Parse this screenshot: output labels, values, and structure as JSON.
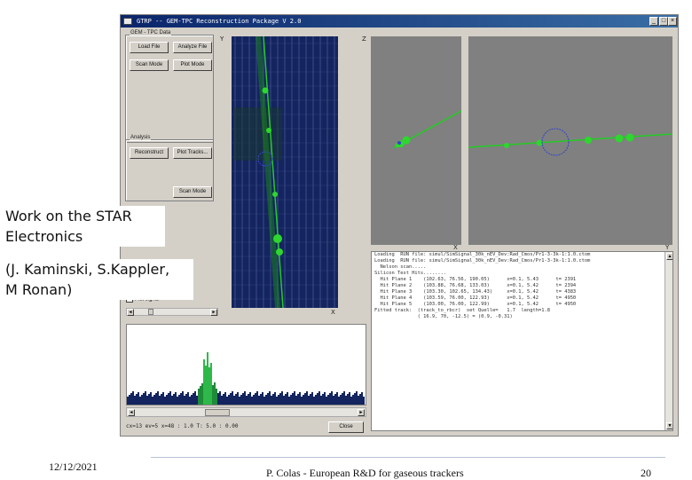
{
  "window": {
    "title": "GTRP -- GEM-TPC Reconstruction Package V 2.0",
    "title_icon": "app-logo-icon",
    "controls": {
      "minimize": "_",
      "maximize": "□",
      "close": "×"
    }
  },
  "left_panel": {
    "group1_label": "GEM - TPC Data",
    "buttons_row1": [
      "Load File",
      "Analyze File"
    ],
    "buttons_row2": [
      "Scan Mode",
      "Plot Mode"
    ],
    "group2_label": "Analysis",
    "buttons_row3": [
      "Reconstruct",
      "Plot Tracks..."
    ],
    "scan_button": "Scan Mode",
    "checkbox_label": "Plot signal",
    "checkbox_checked": true
  },
  "plots": {
    "xy_axis_y": "Y",
    "xy_axis_x": "X",
    "zx_axis_z": "Z",
    "zx_axis_x": "X",
    "zy_axis_y": "Y"
  },
  "console_lines": [
    "Loading  RUN file: simul/SimSignal_30k_nEV_Dev:Rad_Cmos/Pr1-3-3k-1:1.0.ctom",
    "Loading  RUN file: simul/SimSignal_30k_nEV_Dev:Rad_Cmos/Pr1-3-3k-1:1.0.ctom",
    "  Nelson scan.....",
    "Silicon Test Hits........",
    "  Hit Plane 1    (102.63, 76.56, 190.05)      x=0.1, 5.43      t= 2391",
    "  Hit Plane 2    (103.88, 76.68, 133.03)      x=0.1, 5.42      t= 2394",
    "  Hit Plane 3    (103.30, 102.65, 134.43)     x=0.1, 5.42      t= 4383",
    "  Hit Plane 4    (103.59, 76.00, 122.93)      x=0.1, 5.42      t= 4950",
    "  Hit Plane 5    (103.00, 76.00, 122.99)      x=0.1, 5.42      t= 4950",
    "Fitted track:  (track_to_rbcr)  set Quelle=   1.7  length=1.8",
    "               ( 16.9, 70, -12.5) = (0.9, -0.31)"
  ],
  "status_line": "cx=13 ev=5 x=48 : 1.0  T: 5.0 : 0.00",
  "close_button": "Close",
  "slide": {
    "text1_line1": "Work on the STAR",
    "text1_line2": "Electronics",
    "text2_line1": "(J. Kaminski, S.Kappler,",
    "text2_line2": "M Ronan)",
    "footer_date": "12/12/2021",
    "footer_center": "P. Colas  - European R&D for gaseous trackers",
    "footer_page": "20"
  },
  "colors": {
    "window_bg": "#d4d0c8",
    "titlebar": "#0a246a",
    "track_green": "#22cc22",
    "pad_blue": "#13245e",
    "plot_gray": "#808080"
  }
}
